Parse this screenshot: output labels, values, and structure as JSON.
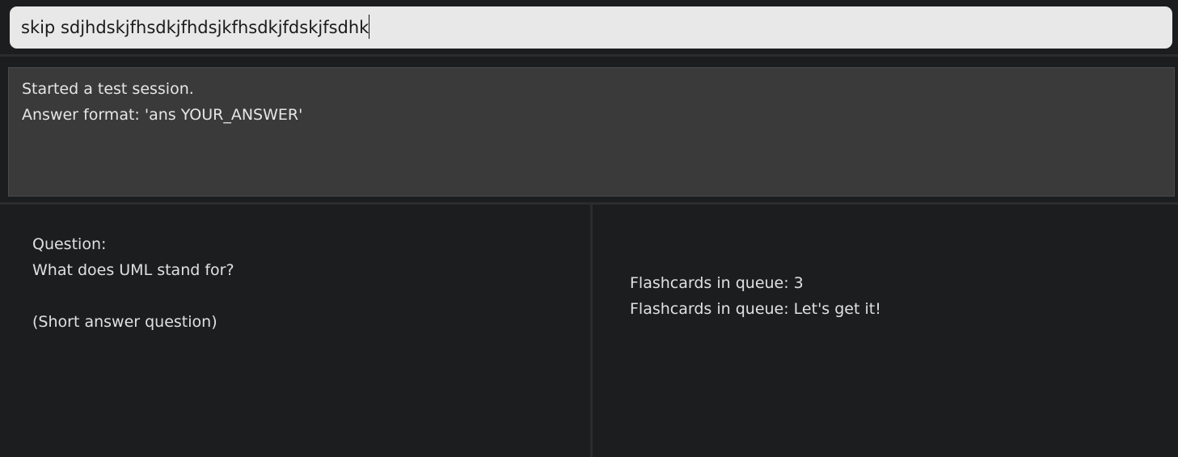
{
  "command_bar": {
    "input_value": "skip sdjhdskjfhsdkjfhdsjkfhsdkjfdskjfsdhk"
  },
  "result_display": {
    "lines": [
      "Started a test session.",
      "Answer format: 'ans YOUR_ANSWER'"
    ]
  },
  "question_panel": {
    "heading": "Question:",
    "question": "What does UML stand for?",
    "type_note": "(Short answer question)"
  },
  "queue_panel": {
    "count_line": "Flashcards in queue: 3",
    "message_line": "Flashcards in queue: Let's get it!"
  },
  "colors": {
    "background": "#1c1d1f",
    "input_background": "#e8e8e8",
    "result_background": "#3a3a3a",
    "text": "#e0e0e0"
  }
}
